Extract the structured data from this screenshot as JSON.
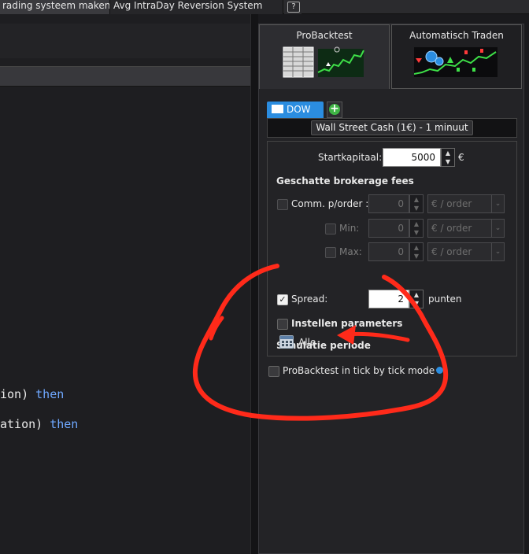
{
  "top_tabs": {
    "tab1": "rading systeem maken",
    "tab2": "Avg IntraDay Reversion System",
    "help_icon": "help-icon"
  },
  "editor": {
    "line1": {
      "prefix": "ion) ",
      "keyword": "then"
    },
    "line2": {
      "prefix": "ation) ",
      "keyword": "then"
    }
  },
  "mode_tabs": {
    "probacktest": "ProBacktest",
    "auto_trade": "Automatisch Traden"
  },
  "instrument_tab": {
    "label": "DOW",
    "add_icon": "plus-circle-icon"
  },
  "instrument": {
    "selected": "Wall Street Cash (1€) - 1 minuut"
  },
  "capital": {
    "label": "Startkapitaal:",
    "value": "5000",
    "currency": "€"
  },
  "fees": {
    "heading": "Geschatte brokerage fees",
    "comm_label": "Comm. p/order :",
    "comm_value": "0",
    "comm_unit": "€ / order",
    "min_label": "Min:",
    "min_value": "0",
    "min_unit": "€ / order",
    "max_label": "Max:",
    "max_value": "0",
    "max_unit": "€ / order",
    "spread_label": "Spread:",
    "spread_value": "2",
    "spread_unit": "punten"
  },
  "params": {
    "label": "Instellen parameters"
  },
  "simulation": {
    "heading": "Simulatie periode",
    "period": "Alle"
  },
  "tick_mode": {
    "label": "ProBacktest in tick by tick mode"
  },
  "colors": {
    "accent_blue": "#2b8de0",
    "annotation_red": "#ff2a1a",
    "add_green": "#3fb445",
    "keyword_blue": "#6fa8ff"
  }
}
